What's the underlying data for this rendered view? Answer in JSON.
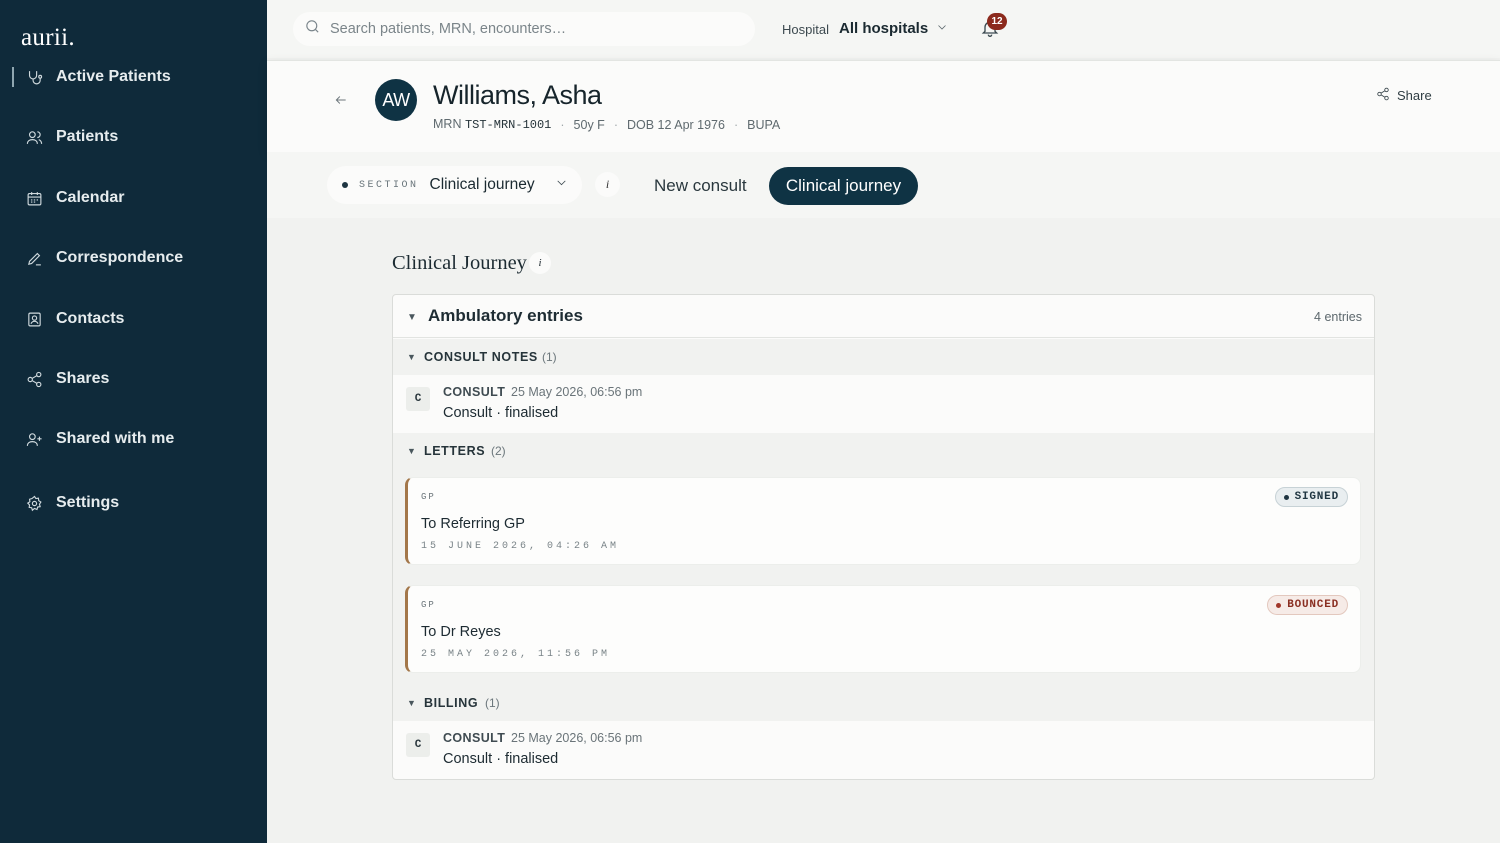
{
  "app": {
    "logo": "aurii."
  },
  "sidebar": {
    "items": [
      {
        "label": "Active Patients",
        "icon": "stethoscope-icon",
        "active": true
      },
      {
        "label": "Patients",
        "icon": "users-icon"
      },
      {
        "label": "Calendar",
        "icon": "calendar-icon"
      },
      {
        "label": "Correspondence",
        "icon": "pen-icon"
      },
      {
        "label": "Contacts",
        "icon": "contact-card-icon"
      },
      {
        "label": "Shares",
        "icon": "share-icon"
      },
      {
        "label": "Shared with me",
        "icon": "user-plus-icon"
      },
      {
        "label": "Settings",
        "icon": "gear-icon"
      }
    ]
  },
  "topbar": {
    "search_placeholder": "Search patients, MRN, encounters…",
    "hospital_label": "Hospital",
    "hospital_value": "All hospitals",
    "notification_count": "12"
  },
  "patient": {
    "initials": "AW",
    "name": "Williams, Asha",
    "mrn_label": "MRN",
    "mrn": "TST-MRN-1001",
    "age_sex": "50y F",
    "dob": "DOB 12 Apr 1976",
    "insurer": "BUPA",
    "share_label": "Share"
  },
  "section_bar": {
    "section_label": "SECTION",
    "section_value": "Clinical journey",
    "info_label": "i",
    "tabs": [
      {
        "label": "New consult",
        "active": false
      },
      {
        "label": "Clinical journey",
        "active": true
      }
    ]
  },
  "journey": {
    "title": "Clinical Journey",
    "info_label": "i",
    "card": {
      "title": "Ambulatory entries",
      "count": "4 entries",
      "groups": [
        {
          "title": "CONSULT NOTES",
          "count": "(1)",
          "entries": [
            {
              "badge": "C",
              "kind": "CONSULT",
              "time": "25 May 2026, 06:56 pm",
              "description": "Consult · finalised"
            }
          ]
        },
        {
          "title": "LETTERS",
          "count": "(2)",
          "letters": [
            {
              "kind": "GP",
              "title": "To Referring GP",
              "date": "15 JUNE 2026, 04:26 AM",
              "status": "SIGNED"
            },
            {
              "kind": "GP",
              "title": "To Dr Reyes",
              "date": "25 MAY 2026, 11:56 PM",
              "status": "BOUNCED"
            }
          ]
        },
        {
          "title": "BILLING",
          "count": "(1)",
          "entries": [
            {
              "badge": "C",
              "kind": "CONSULT",
              "time": "25 May 2026, 06:56 pm",
              "description": "Consult · finalised"
            }
          ]
        }
      ]
    }
  },
  "colors": {
    "sidebar_bg": "#0f2a3a",
    "accent": "#0f3344",
    "signed": "#1f3541",
    "bounced": "#a1372a",
    "letter_border": "#a3774a",
    "notification_badge": "#8c2a1d"
  }
}
